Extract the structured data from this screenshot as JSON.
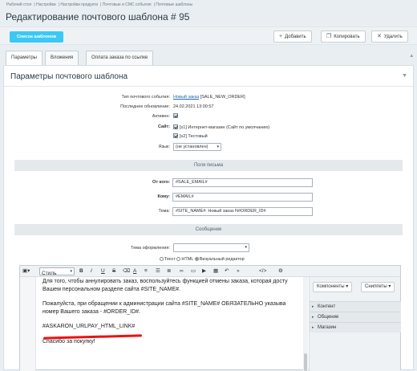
{
  "breadcrumbs": [
    "Рабочий стол",
    "Настройки",
    "Настройки продукта",
    "Почтовые и СМС события",
    "Почтовые шаблоны"
  ],
  "title": "Редактирование почтового шаблона # 95",
  "toolbar": {
    "list": "Список шаблонов",
    "add": "Добавить",
    "copy": "Копировать",
    "delete": "Удалить"
  },
  "tabs": [
    "Параметры",
    "Вложения",
    "Оплата заказа по ссылке"
  ],
  "panel_title": "Параметры почтового шаблона",
  "form": {
    "event_type_label": "Тип почтового события:",
    "event_type_link": "Новый заказ",
    "event_type_code": "[SALE_NEW_ORDER]",
    "updated_label": "Последнее обновление:",
    "updated_value": "24.02.2021 13:00:57",
    "active_label": "Активен:",
    "site_label": "Сайт:",
    "site_1": "[s1] Интернет-магазин (Сайт по умолчанию)",
    "site_2": "[s2] Тестовый",
    "lang_label": "Язык:",
    "lang_value": "(не установлен)"
  },
  "letter_section": "Поля письма",
  "fields": {
    "from_label": "От кого:",
    "from_value": "#SALE_EMAIL#",
    "to_label": "Кому:",
    "to_value": "#EMAIL#",
    "subject_label": "Тема:",
    "subject_value": "#SITE_NAME#: Новый заказ N#ORDER_ID#"
  },
  "message_section": "Сообщение",
  "theme_label": "Тема оформления:",
  "modes": {
    "text": "Текст",
    "html": "HTML",
    "visual": "Визуальный редактор"
  },
  "editor": {
    "style": "Стиль",
    "line1": "Для того, чтобы аннулировать заказ, воспользуйтесь функцией отмены заказа, которая досту",
    "line2": "Вашем персональном разделе сайта #SITE_NAME#.",
    "line3": "Пожалуйста, при обращении к администрации сайта #SITE_NAME# ОБЯЗАТЕЛЬНО указыва",
    "line4": "номер Вашего заказа - #ORDER_ID#.",
    "line5": "#ASKARON_URLPAY_HTML_LINK#",
    "line6": "Спасибо за покупку!"
  },
  "sidebar": {
    "components": "Компоненты",
    "snippets": "Сниппеты",
    "items": [
      "Контент",
      "Общение",
      "Магазин"
    ]
  }
}
